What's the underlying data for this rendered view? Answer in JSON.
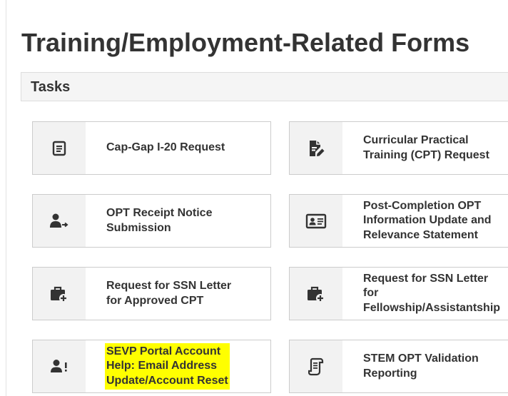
{
  "page": {
    "title": "Training/Employment-Related Forms"
  },
  "section": {
    "title": "Tasks"
  },
  "cards": [
    {
      "label": "Cap-Gap I-20 Request",
      "icon": "document-lines-icon"
    },
    {
      "label": "Curricular Practical\nTraining (CPT) Request",
      "icon": "document-edit-icon"
    },
    {
      "label": "OPT Receipt Notice\nSubmission",
      "icon": "user-arrow-icon"
    },
    {
      "label": "Post-Completion OPT\nInformation Update and\nRelevance Statement",
      "icon": "id-card-icon"
    },
    {
      "label": "Request for SSN Letter\nfor Approved CPT",
      "icon": "briefcase-plus-icon"
    },
    {
      "label": "Request for SSN Letter\nfor\nFellowship/Assistantship",
      "icon": "briefcase-plus-icon"
    },
    {
      "label": "SEVP Portal Account\nHelp: Email Address\nUpdate/Account Reset",
      "icon": "user-alert-icon",
      "highlighted": true
    },
    {
      "label": "STEM OPT Validation\nReporting",
      "icon": "scroll-icon"
    }
  ],
  "colors": {
    "text": "#333333",
    "highlight": "#ffff00",
    "icon_bg": "#f2f2f2",
    "border": "#cccccc"
  }
}
